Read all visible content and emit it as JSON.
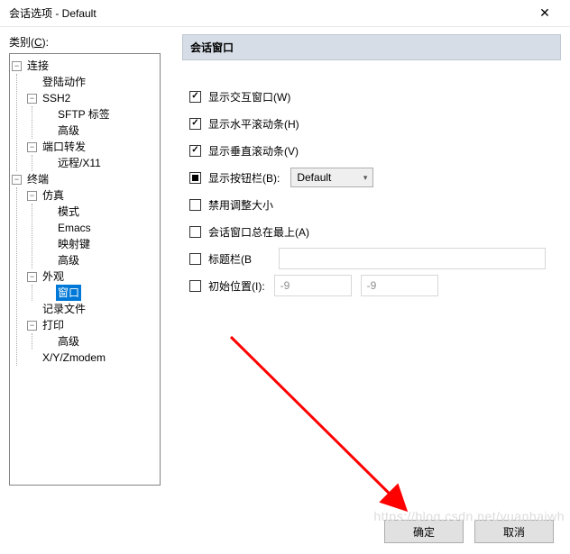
{
  "titlebar": {
    "title": "会话选项 - Default"
  },
  "category_label_pre": "类别(",
  "category_label_hot": "C",
  "category_label_post": "):",
  "tree": {
    "n0": "连接",
    "n0_0": "登陆动作",
    "n0_1": "SSH2",
    "n0_1_0": "SFTP 标签",
    "n0_1_1": "高级",
    "n0_2": "端口转发",
    "n0_2_0": "远程/X11",
    "n1": "终端",
    "n1_0": "仿真",
    "n1_0_0": "模式",
    "n1_0_1": "Emacs",
    "n1_0_2": "映射键",
    "n1_0_3": "高级",
    "n1_1": "外观",
    "n1_1_0": "窗口",
    "n1_2": "记录文件",
    "n1_3": "打印",
    "n1_3_0": "高级",
    "n1_4": "X/Y/Zmodem"
  },
  "section_title": "会话窗口",
  "opts": {
    "show_interact": "显示交互窗口(W)",
    "show_hscroll": "显示水平滚动条(H)",
    "show_vscroll": "显示垂直滚动条(V)",
    "show_btnbar": "显示按钮栏(B):",
    "btnbar_value": "Default",
    "disable_resize": "禁用调整大小",
    "always_top": "会话窗口总在最上(A)",
    "titlebar": "标题栏(B",
    "init_pos": "初始位置(I):",
    "posx": "-9",
    "posy": "-9"
  },
  "buttons": {
    "ok": "确定",
    "cancel": "取消"
  },
  "watermark": "https://blog.csdn.net/yuanhaiwh"
}
